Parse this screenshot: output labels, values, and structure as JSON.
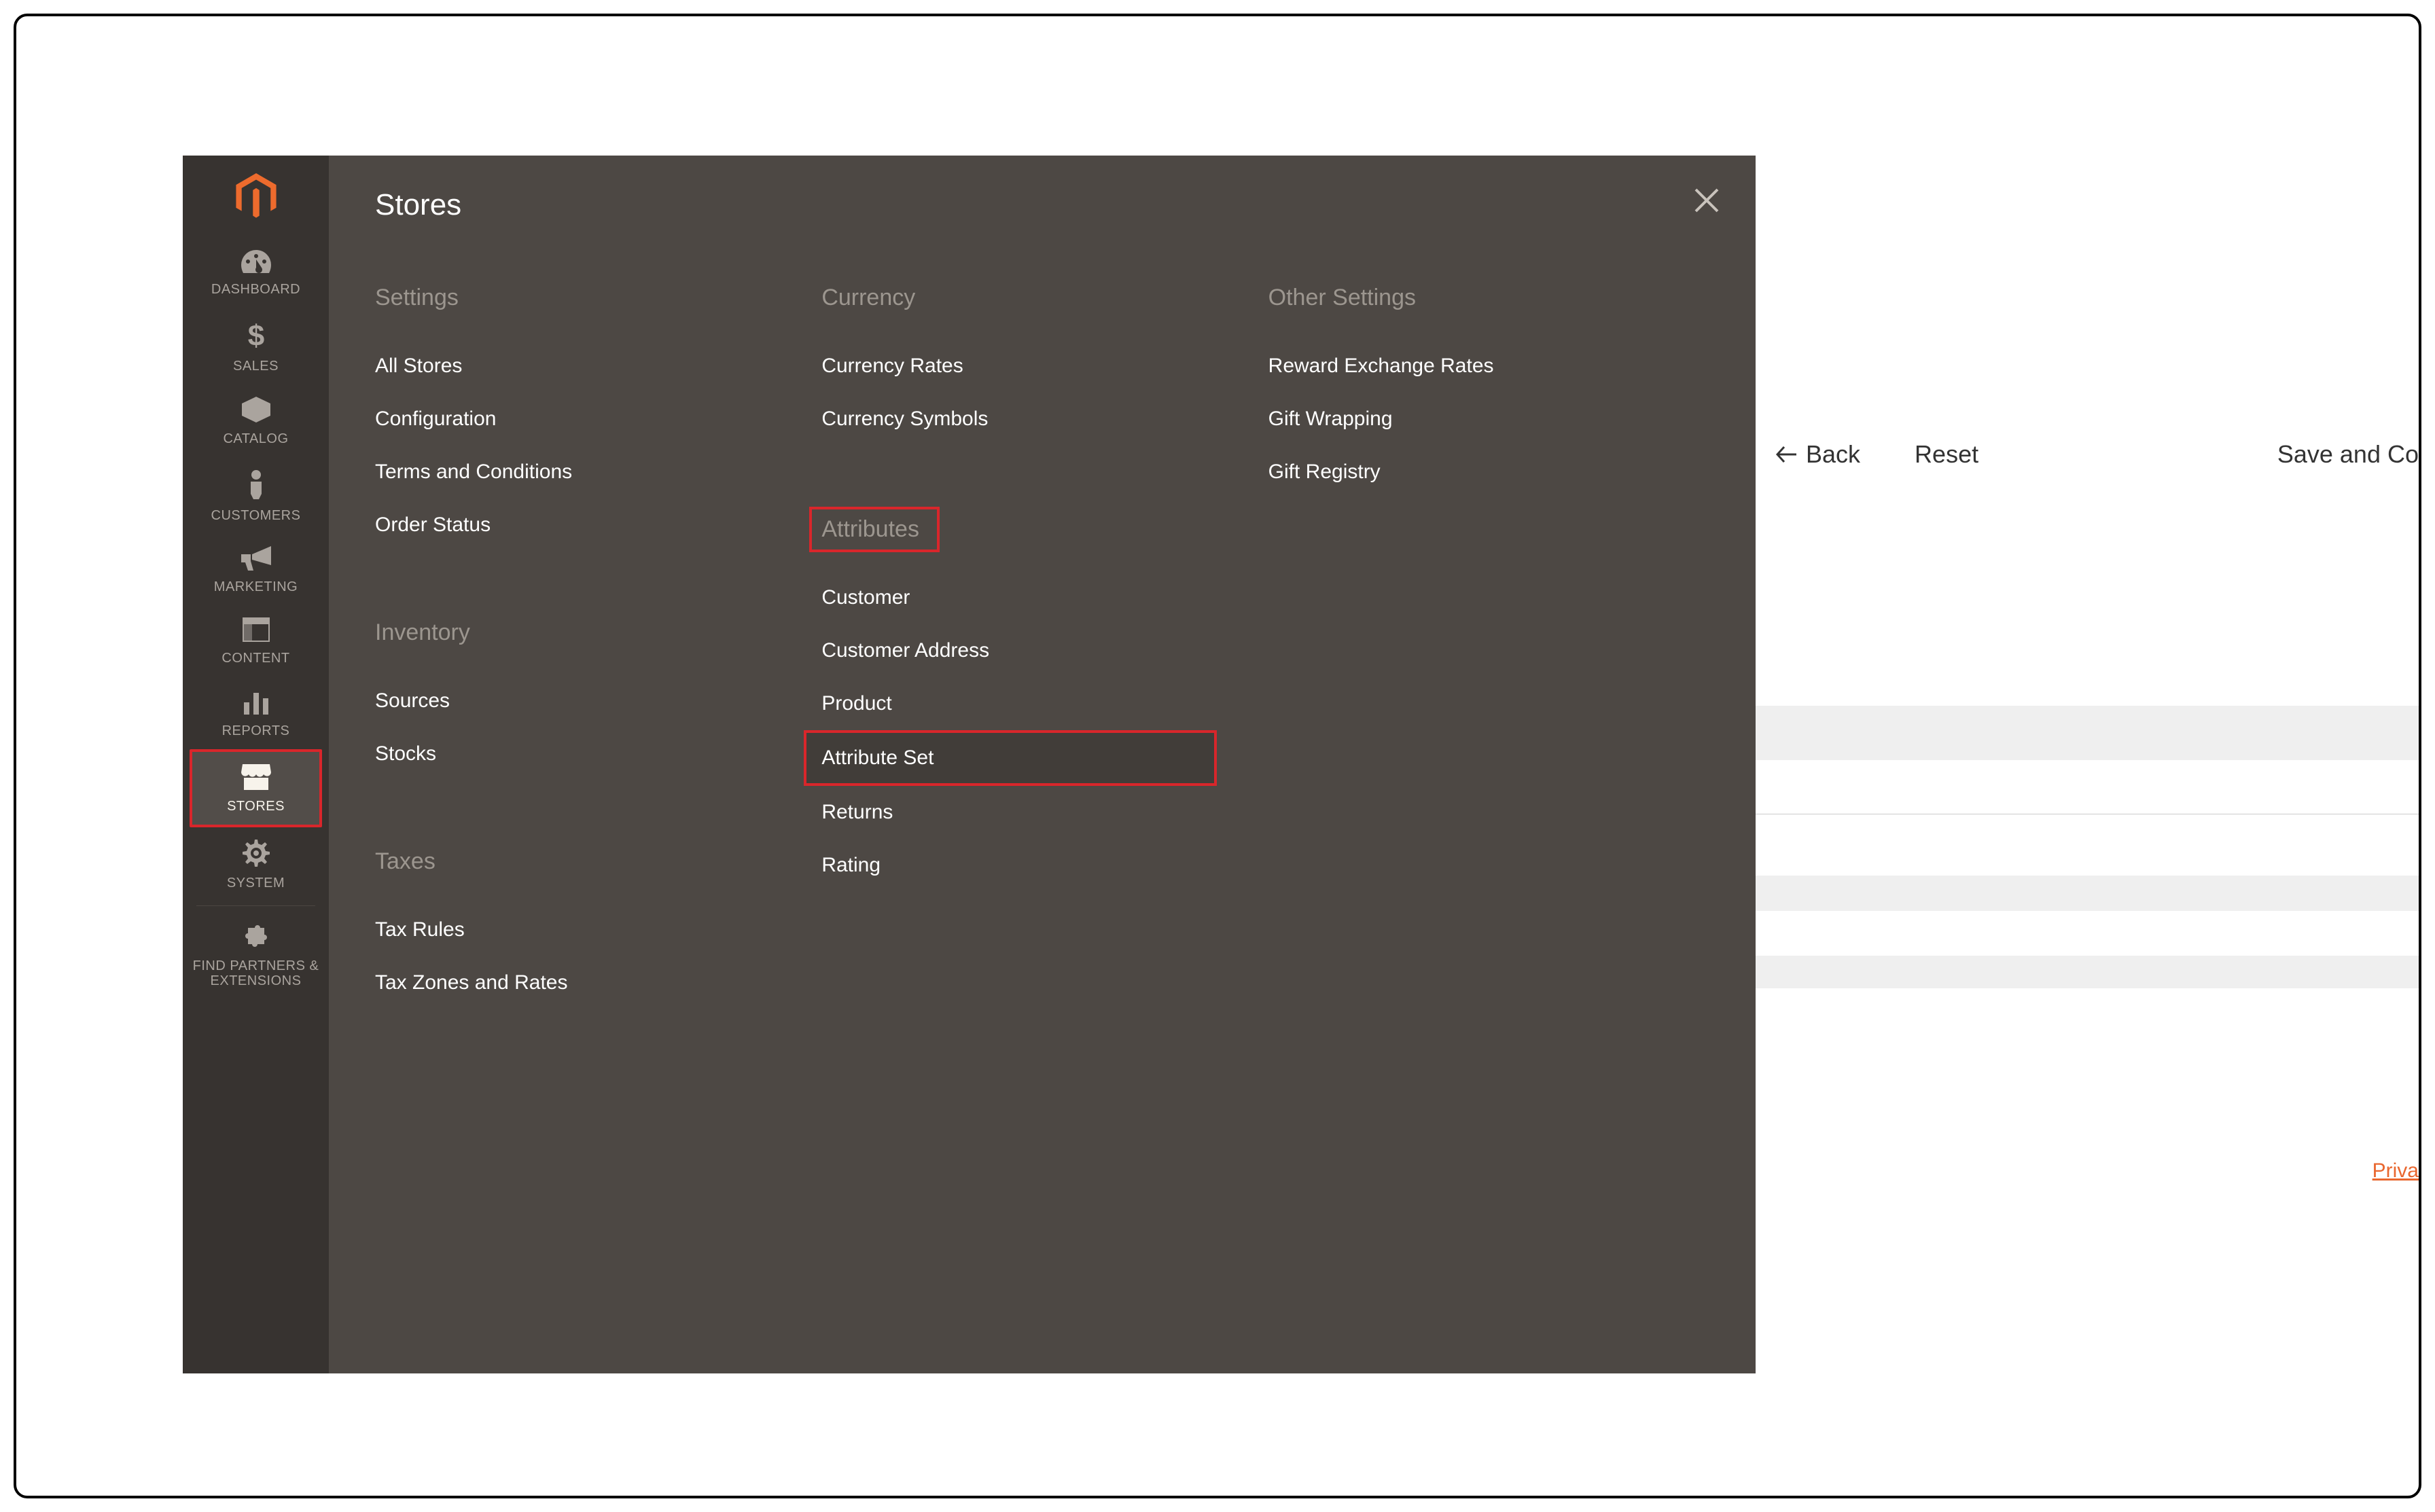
{
  "sidebar": {
    "items": [
      {
        "label": "DASHBOARD"
      },
      {
        "label": "SALES"
      },
      {
        "label": "CATALOG"
      },
      {
        "label": "CUSTOMERS"
      },
      {
        "label": "MARKETING"
      },
      {
        "label": "CONTENT"
      },
      {
        "label": "REPORTS"
      },
      {
        "label": "STORES"
      },
      {
        "label": "SYSTEM"
      },
      {
        "label": "FIND PARTNERS & EXTENSIONS"
      }
    ]
  },
  "flyout": {
    "title": "Stores",
    "columns": {
      "settings": {
        "heading": "Settings",
        "items": [
          "All Stores",
          "Configuration",
          "Terms and Conditions",
          "Order Status"
        ]
      },
      "inventory": {
        "heading": "Inventory",
        "items": [
          "Sources",
          "Stocks"
        ]
      },
      "taxes": {
        "heading": "Taxes",
        "items": [
          "Tax Rules",
          "Tax Zones and Rates"
        ]
      },
      "currency": {
        "heading": "Currency",
        "items": [
          "Currency Rates",
          "Currency Symbols"
        ]
      },
      "attributes": {
        "heading": "Attributes",
        "items": [
          "Customer",
          "Customer Address",
          "Product",
          "Attribute Set",
          "Returns",
          "Rating"
        ]
      },
      "other": {
        "heading": "Other Settings",
        "items": [
          "Reward Exchange Rates",
          "Gift Wrapping",
          "Gift Registry"
        ]
      }
    }
  },
  "actions": {
    "back": "Back",
    "reset": "Reset",
    "save": "Save and Co"
  },
  "footer": {
    "privacy": "Priva"
  }
}
